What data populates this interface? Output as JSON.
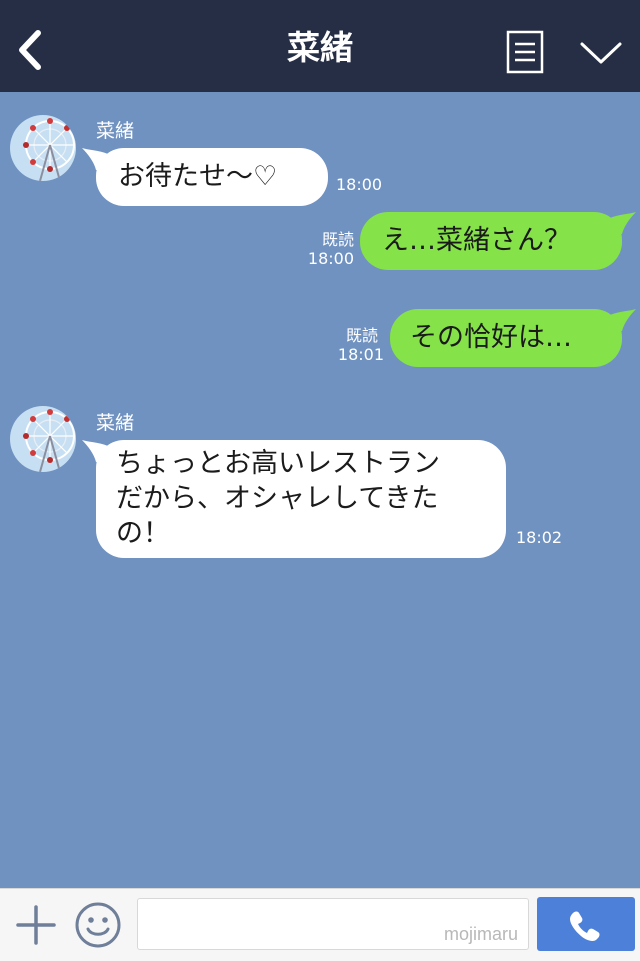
{
  "header": {
    "title": "菜緒",
    "back_icon": "chevron-left-icon",
    "menu_icon": "note-list-icon",
    "more_icon": "chevron-down-icon"
  },
  "messages": [
    {
      "direction": "in",
      "sender": "菜緒",
      "text": "お待たせ〜♡",
      "time": "18:00"
    },
    {
      "direction": "out",
      "text": "え…菜緒さん？",
      "read": "既読",
      "time": "18:00"
    },
    {
      "direction": "out",
      "text": "その恰好は…",
      "read": "既読",
      "time": "18:01"
    },
    {
      "direction": "in",
      "sender": "菜緒",
      "text": "ちょっとお高いレストラン\nだから、オシャレしてきた\nの！",
      "time": "18:02"
    }
  ],
  "input_bar": {
    "placeholder": "",
    "watermark": "mojimaru",
    "plus_icon": "plus-icon",
    "emoji_icon": "smiley-icon",
    "call_icon": "phone-icon"
  },
  "colors": {
    "header_bg": "#252e45",
    "chat_bg": "#7092c1",
    "bubble_in": "#ffffff",
    "bubble_out": "#85e249",
    "call_button": "#4d80d8"
  }
}
